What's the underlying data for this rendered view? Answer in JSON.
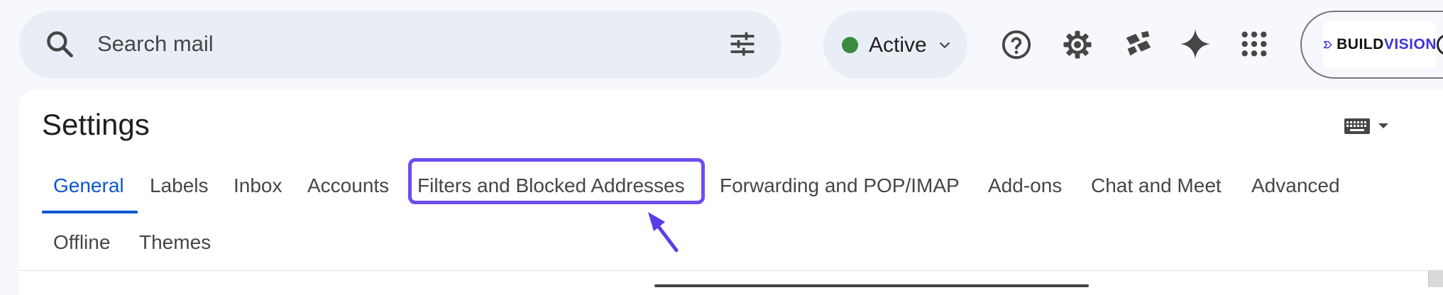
{
  "header": {
    "search": {
      "placeholder": "Search mail"
    },
    "status": {
      "label": "Active",
      "color": "#3b8b3e"
    },
    "icons": [
      "search-icon",
      "tune-icon",
      "chevron-down-icon",
      "help-icon",
      "gear-icon",
      "gemini-app-icon",
      "sparkle-icon",
      "apps-grid-icon"
    ],
    "account": {
      "brand_prefix": "BUILD",
      "brand_suffix": "VISION",
      "brand_color": "#3d34d9"
    }
  },
  "settings": {
    "title": "Settings",
    "tabs_row1": [
      "General",
      "Labels",
      "Inbox",
      "Accounts",
      "Filters and Blocked Addresses",
      "Forwarding and POP/IMAP",
      "Add-ons",
      "Chat and Meet",
      "Advanced"
    ],
    "tabs_row2": [
      "Offline",
      "Themes"
    ],
    "active_tab": "General",
    "highlighted_tab": "Filters and Blocked Addresses",
    "accent_color": "#0b57d0",
    "highlight_color": "#6f4cf0"
  }
}
